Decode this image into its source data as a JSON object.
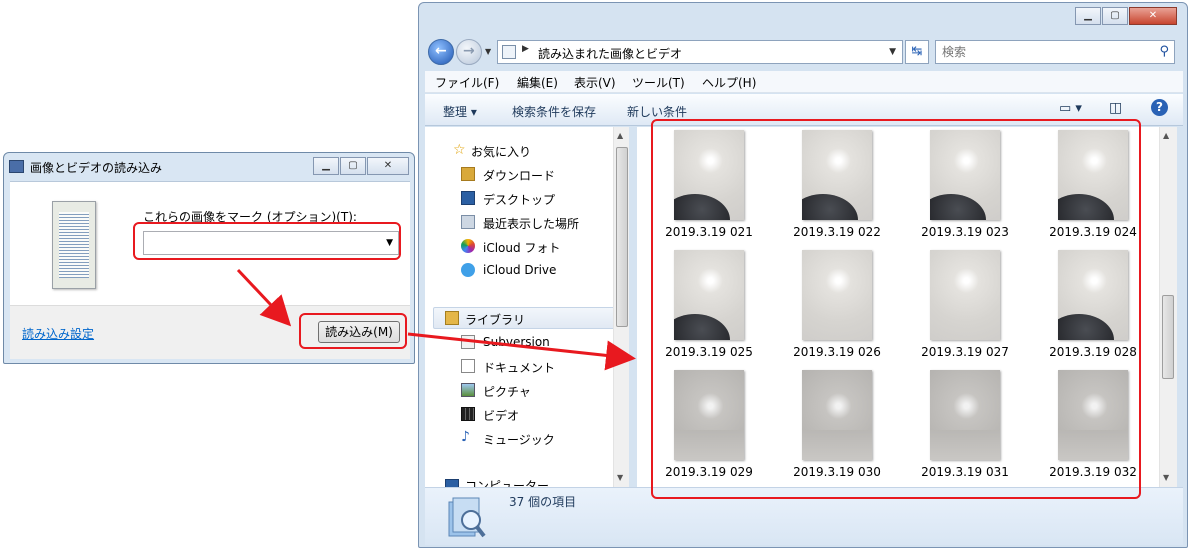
{
  "dialog": {
    "title": "画像とビデオの読み込み",
    "tag_label": "これらの画像をマーク (オプション)(T):",
    "tag_value": "",
    "settings_link": "読み込み設定",
    "import_button": "読み込み(M)"
  },
  "explorer": {
    "address": "読み込まれた画像とビデオ",
    "search_placeholder": "検索",
    "menu": [
      "ファイル(F)",
      "編集(E)",
      "表示(V)",
      "ツール(T)",
      "ヘルプ(H)"
    ],
    "toolbar": {
      "organize": "整理 ▾",
      "save_search": "検索条件を保存",
      "new_condition": "新しい条件"
    },
    "nav": {
      "favorites": "お気に入り",
      "downloads": "ダウンロード",
      "desktop": "デスクトップ",
      "recent": "最近表示した場所",
      "icloud_photos": "iCloud フォト",
      "icloud_drive": "iCloud Drive",
      "libraries": "ライブラリ",
      "subversion": "Subversion",
      "documents": "ドキュメント",
      "pictures": "ピクチャ",
      "videos": "ビデオ",
      "music": "ミュージック",
      "computer": "コンピューター"
    },
    "files": [
      "2019.3.19 021",
      "2019.3.19 022",
      "2019.3.19 023",
      "2019.3.19 024",
      "2019.3.19 025",
      "2019.3.19 026",
      "2019.3.19 027",
      "2019.3.19 028",
      "2019.3.19 029",
      "2019.3.19 030",
      "2019.3.19 031",
      "2019.3.19 032"
    ],
    "status": "37 個の項目"
  },
  "colors": {
    "annotation": "#e8191f",
    "link": "#0066cc",
    "window_frame": "#d5e3f1"
  }
}
